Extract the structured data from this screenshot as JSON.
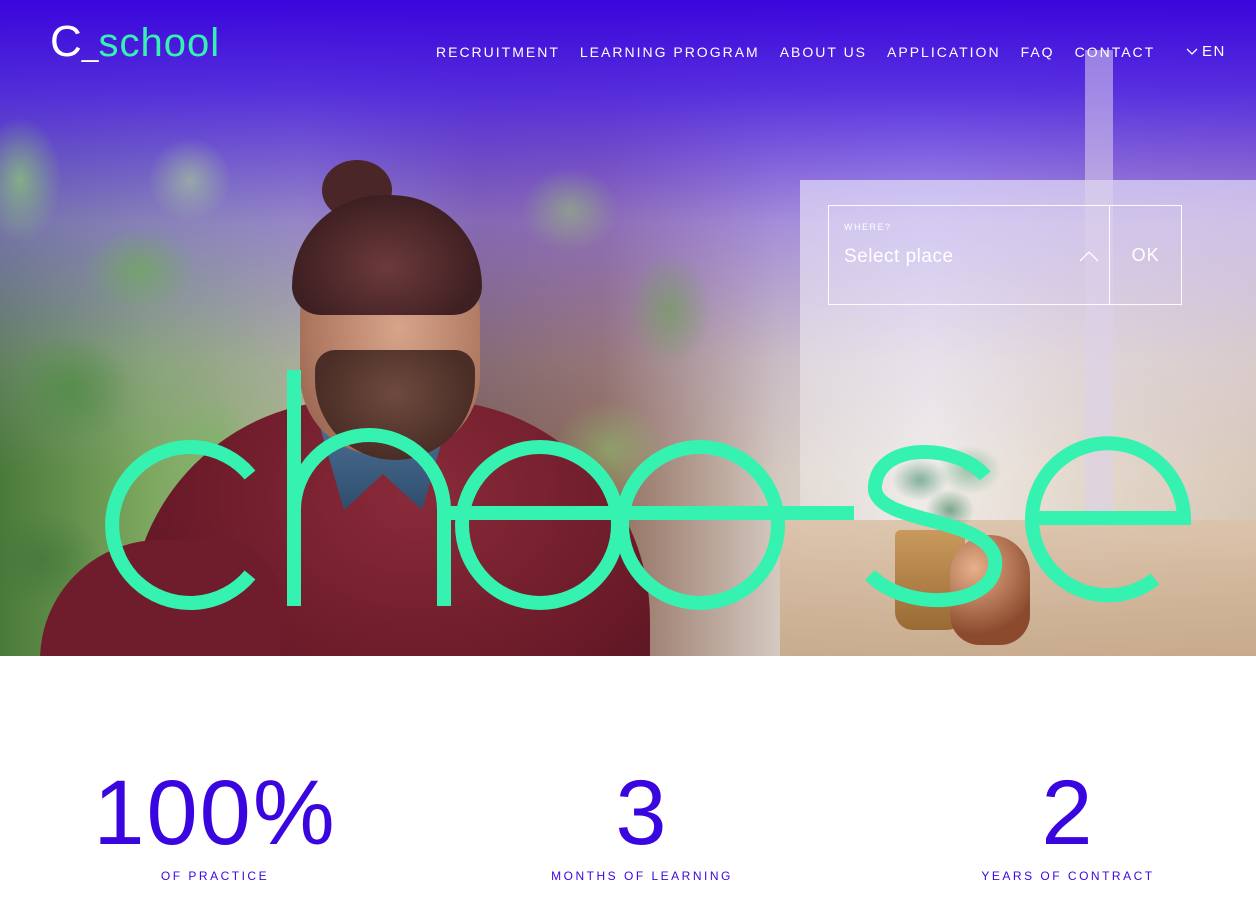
{
  "brand": {
    "logo_c": "C",
    "logo_underscore": "_",
    "logo_rest": "school",
    "primary_color": "#3a06e0",
    "accent_color": "#35f2b0"
  },
  "nav": {
    "items": [
      {
        "label": "RECRUITMENT"
      },
      {
        "label": "LEARNING PROGRAM"
      },
      {
        "label": "ABOUT US"
      },
      {
        "label": "APPLICATION"
      },
      {
        "label": "FAQ"
      },
      {
        "label": "CONTACT"
      }
    ],
    "language": "EN",
    "language_icon": "chevron-down-icon"
  },
  "place_selector": {
    "label": "WHERE?",
    "value": "Select place",
    "chevron_icon": "chevron-up-icon",
    "ok_label": "OK"
  },
  "hero": {
    "headline": "choose"
  },
  "stats": [
    {
      "value": "100%",
      "label": "OF PRACTICE"
    },
    {
      "value": "3",
      "label": "MONTHS OF LEARNING"
    },
    {
      "value": "2",
      "label": "YEARS OF CONTRACT"
    }
  ]
}
